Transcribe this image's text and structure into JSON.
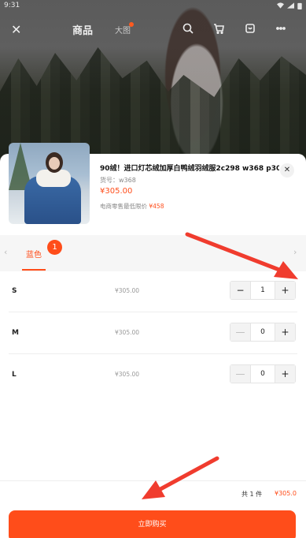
{
  "status_bar": {
    "time": "9:31"
  },
  "nav": {
    "tab_goods": "商品",
    "tab_big": "大图"
  },
  "product": {
    "title": "90绒！进口灯芯绒加厚白鸭绒羽绒服2c298 w368 p30...",
    "sku_label": "货号：w368",
    "price": "¥305.00",
    "min_price_label": "电商零售最低限价",
    "min_price_value": "¥458"
  },
  "colors": {
    "selected": "蓝色",
    "badge": "1",
    "prev_arrow": "‹",
    "next_arrow": "›"
  },
  "sizes": [
    {
      "label": "S",
      "price": "¥305.00",
      "qty": "1",
      "minus": "−",
      "plus": "+",
      "can_decrease": true
    },
    {
      "label": "M",
      "price": "¥305.00",
      "qty": "0",
      "minus": "—",
      "plus": "+",
      "can_decrease": false
    },
    {
      "label": "L",
      "price": "¥305.00",
      "qty": "0",
      "minus": "—",
      "plus": "+",
      "can_decrease": false
    }
  ],
  "summary": {
    "count": "共 1 件",
    "price": "¥305.0"
  },
  "buy_button": "立即购买",
  "colors_theme": {
    "accent": "#ff4d1a",
    "annotation": "#f03c2e"
  },
  "icons": [
    "close-icon",
    "search-icon",
    "cart-icon",
    "store-icon",
    "more-icon",
    "wifi-icon",
    "signal-icon",
    "battery-icon"
  ]
}
